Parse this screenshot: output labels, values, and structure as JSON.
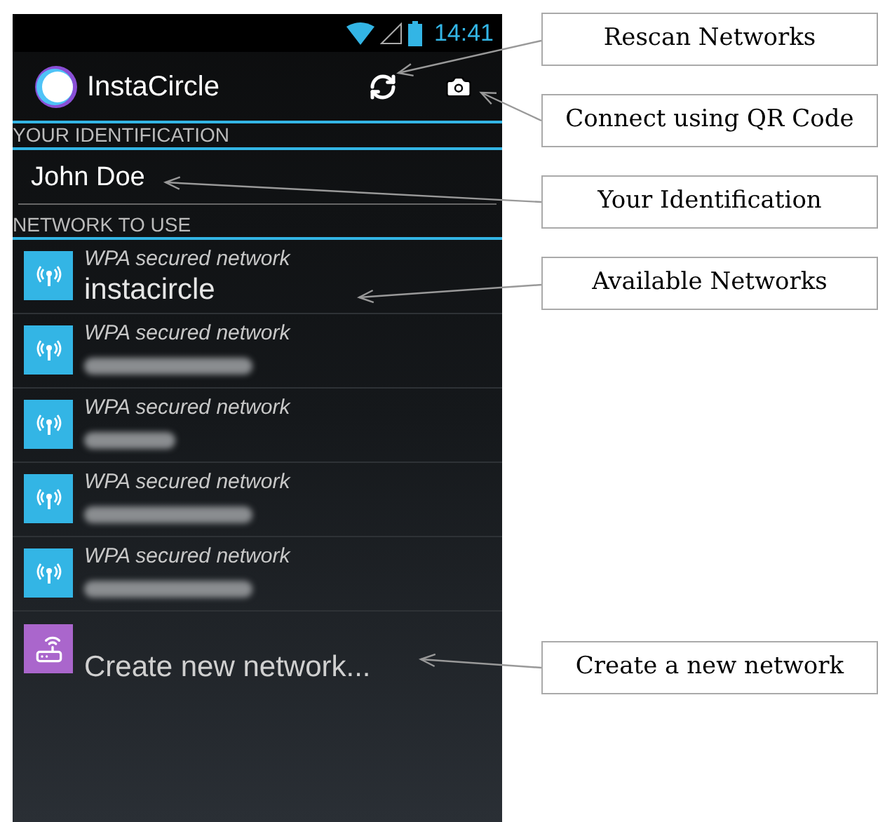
{
  "status_bar": {
    "time": "14:41"
  },
  "action_bar": {
    "title": "InstaCircle"
  },
  "identification": {
    "header": "YOUR IDENTIFICATION",
    "value": "John Doe"
  },
  "networks_section": {
    "header": "NETWORK TO USE"
  },
  "networks": [
    {
      "kind": "named",
      "security": "WPA secured network",
      "name": "instacircle"
    },
    {
      "kind": "redacted",
      "security": "WPA secured network"
    },
    {
      "kind": "redacted",
      "security": "WPA secured network"
    },
    {
      "kind": "redacted",
      "security": "WPA secured network"
    },
    {
      "kind": "redacted",
      "security": "WPA secured network"
    }
  ],
  "create_network": {
    "label": "Create new network..."
  },
  "callouts": [
    "Rescan Networks",
    "Connect using QR Code",
    "Your Identification",
    "Available Networks",
    "Create a new network"
  ]
}
